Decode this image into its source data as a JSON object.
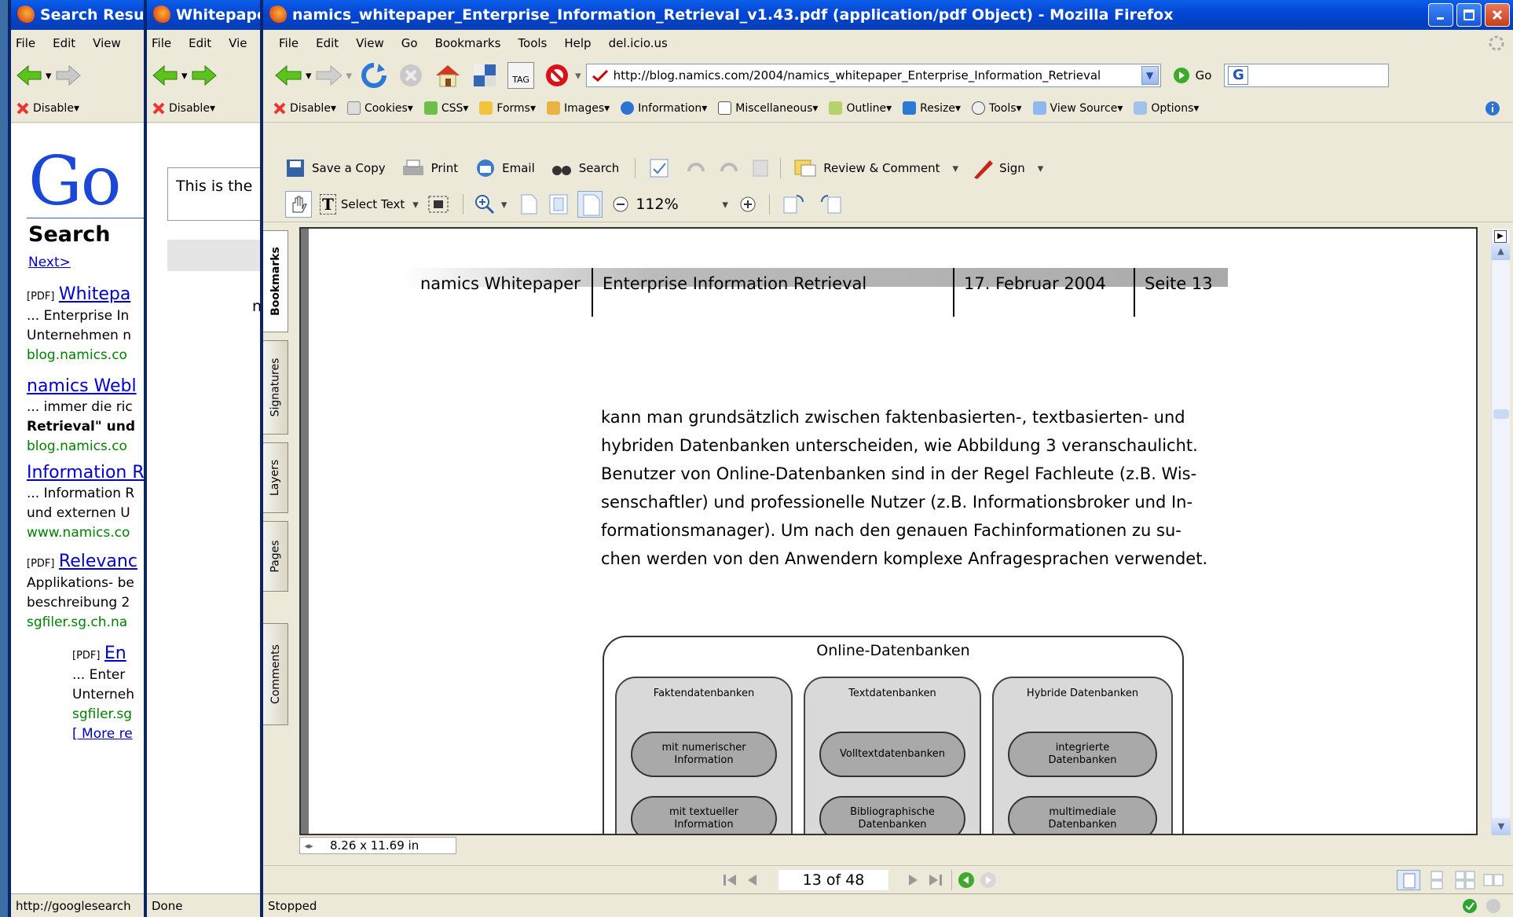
{
  "win1": {
    "title": "Search Resu",
    "menu": [
      "File",
      "Edit",
      "View"
    ],
    "wdtb_disable": "Disable",
    "logo": "Go",
    "search_heading": "Search",
    "next_link": "Next>",
    "results": [
      {
        "tag": "[PDF]",
        "title": "Whitepa",
        "lines": [
          "... Enterprise In",
          "Unternehmen n"
        ],
        "url": "blog.namics.co"
      },
      {
        "tag": "",
        "title": "namics Webl",
        "lines": [
          "... immer die ric",
          "Retrieval\" und"
        ],
        "url": "blog.namics.co"
      },
      {
        "tag": "",
        "title": "Information R",
        "lines": [
          "... Information R",
          "und externen U"
        ],
        "url": "www.namics.co"
      },
      {
        "tag": "[PDF]",
        "title": "Relevanc",
        "lines": [
          "Applikations- be",
          "beschreibung 2"
        ],
        "url": "sgfiler.sg.ch.na"
      },
      {
        "tag": "[PDF]",
        "title": "En",
        "lines": [
          "... Enter",
          "Unterneh"
        ],
        "url": "sgfiler.sg"
      }
    ],
    "more_link": "[ More re",
    "status": "http://googlesearch"
  },
  "win2": {
    "title": "Whitepape",
    "menu": [
      "File",
      "Edit",
      "Vie"
    ],
    "wdtb_disable": "Disable",
    "content_text": "This is the",
    "letter": "n",
    "status": "Done"
  },
  "win3": {
    "title": "namics_whitepaper_Enterprise_Information_Retrieval_v1.43.pdf (application/pdf Object) - Mozilla Firefox",
    "menu": [
      "File",
      "Edit",
      "View",
      "Go",
      "Bookmarks",
      "Tools",
      "Help",
      "del.icio.us"
    ],
    "url": "http://blog.namics.com/2004/namics_whitepaper_Enterprise_Information_Retrieval",
    "go_label": "Go",
    "search_icon_letter": "G",
    "tag_label": "TAG",
    "webdev": [
      "Disable",
      "Cookies",
      "CSS",
      "Forms",
      "Images",
      "Information",
      "Miscellaneous",
      "Outline",
      "Resize",
      "Tools",
      "View Source",
      "Options"
    ],
    "reader1": {
      "save": "Save a Copy",
      "print": "Print",
      "email": "Email",
      "search": "Search",
      "review": "Review & Comment",
      "sign": "Sign"
    },
    "reader2": {
      "select_text": "Select Text",
      "zoom": "112%"
    },
    "side_tabs": [
      "Bookmarks",
      "Signatures",
      "Layers",
      "Pages",
      "Comments"
    ],
    "page_header": {
      "c1": "namics Whitepaper",
      "c2": "Enterprise Information Retrieval",
      "c3": "17. Februar 2004",
      "c4": "Seite 13"
    },
    "paragraph": [
      "kann man grundsätzlich zwischen faktenbasierten-, textbasierten- und",
      "hybriden Datenbanken unterscheiden, wie Abbildung 3 veranschaulicht.",
      "Benutzer von Online-Datenbanken sind in der Regel Fachleute (z.B. Wis-",
      "senschaftler) und professionelle Nutzer (z.B. Informationsbroker und In-",
      "formationsmanager). Um nach den genauen Fachinformationen zu su-",
      "chen werden von den Anwendern komplexe Anfragesprachen verwendet."
    ],
    "diagram": {
      "title": "Online-Datenbanken",
      "cols": [
        {
          "title": "Faktendatenbanken",
          "items": [
            "mit numerischer\nInformation",
            "mit textueller\nInformation"
          ]
        },
        {
          "title": "Textdatenbanken",
          "items": [
            "Volltextdatenbanken",
            "Bibliographische\nDatenbanken"
          ]
        },
        {
          "title": "Hybride Datenbanken",
          "items": [
            "integrierte\nDatenbanken",
            "multimediale\nDatenbanken"
          ]
        }
      ]
    },
    "page_size": "8.26 x 11.69 in",
    "page_nav": "13 of 48",
    "status": "Stopped"
  }
}
